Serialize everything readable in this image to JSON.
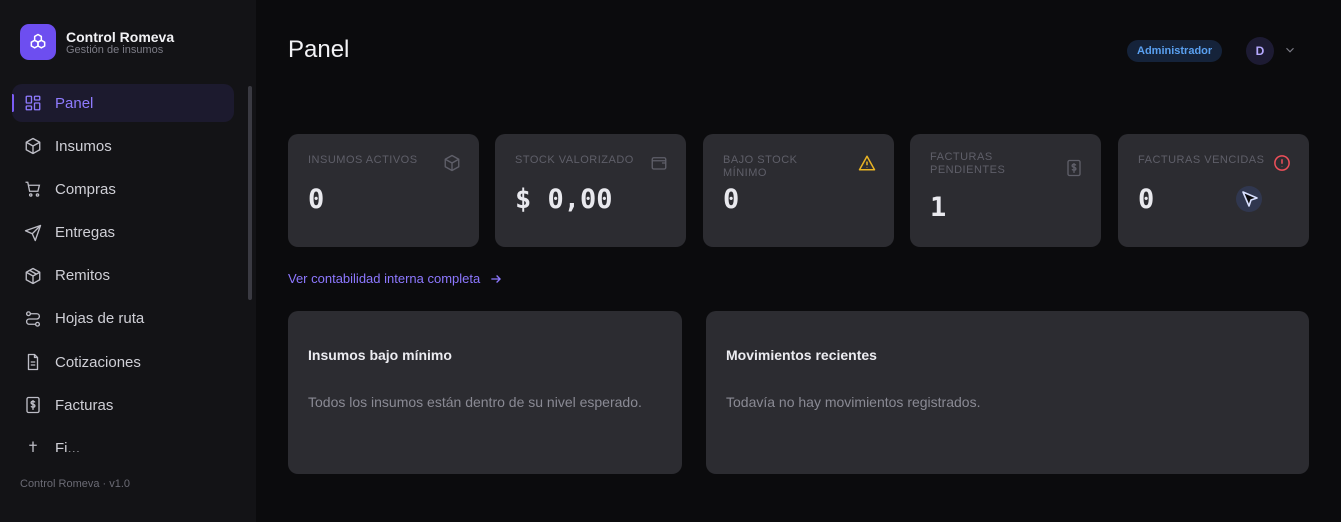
{
  "brand": {
    "name": "Control Romeva",
    "subtitle": "Gestión de insumos"
  },
  "sidebar": {
    "items": [
      {
        "label": "Panel",
        "icon": "dashboard-icon",
        "active": true
      },
      {
        "label": "Insumos",
        "icon": "box-icon"
      },
      {
        "label": "Compras",
        "icon": "cart-icon"
      },
      {
        "label": "Entregas",
        "icon": "send-icon"
      },
      {
        "label": "Remitos",
        "icon": "package-icon"
      },
      {
        "label": "Hojas de ruta",
        "icon": "route-icon"
      },
      {
        "label": "Cotizaciones",
        "icon": "document-icon"
      },
      {
        "label": "Facturas",
        "icon": "invoice-icon"
      },
      {
        "label": "Fi...",
        "icon": "finance-icon"
      }
    ],
    "version": "Control Romeva · v1.0"
  },
  "header": {
    "title": "Panel",
    "role": "Administrador",
    "avatar_initial": "D"
  },
  "stats": [
    {
      "label": "INSUMOS ACTIVOS",
      "value": "0",
      "icon": "box-icon"
    },
    {
      "label": "STOCK VALORIZADO",
      "value": "$ 0,00",
      "icon": "wallet-icon"
    },
    {
      "label": "BAJO STOCK MÍNIMO",
      "value": "0",
      "icon": "warning-icon",
      "icon_color": "#e8b324"
    },
    {
      "label": "FACTURAS PENDIENTES",
      "value": "1",
      "icon": "invoice-icon"
    },
    {
      "label": "FACTURAS VENCIDAS",
      "value": "0",
      "icon": "alert-circle-icon",
      "icon_color": "#ef4f5a"
    }
  ],
  "link": {
    "label": "Ver contabilidad interna completa"
  },
  "panels": [
    {
      "title": "Insumos bajo mínimo",
      "text": "Todos los insumos están dentro de su nivel esperado."
    },
    {
      "title": "Movimientos recientes",
      "text": "Todavía no hay movimientos registrados."
    }
  ],
  "colors": {
    "accent": "#7b5cf6",
    "warning": "#e8b324",
    "danger": "#ef4f5a",
    "info": "#5aa0f0"
  }
}
